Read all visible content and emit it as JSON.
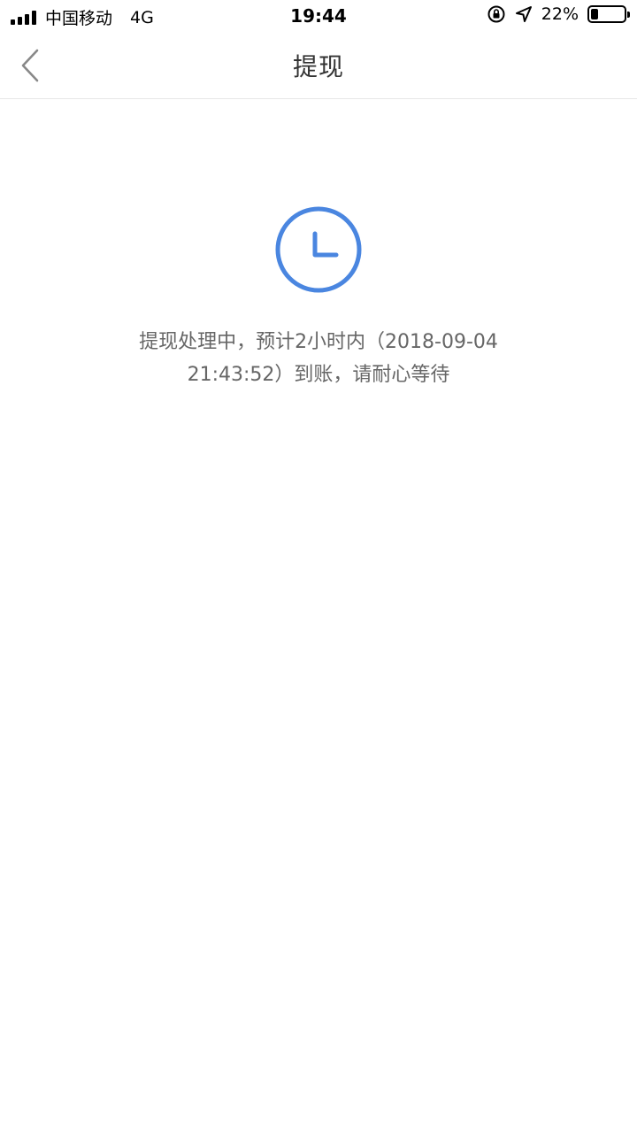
{
  "status_bar": {
    "carrier": "中国移动",
    "network": "4G",
    "time": "19:44",
    "battery_percent": "22%",
    "battery_level": 0.22,
    "icons": [
      "signal-icon",
      "orientation-lock-icon",
      "location-arrow-icon",
      "battery-icon"
    ]
  },
  "nav": {
    "title": "提现",
    "back_icon": "chevron-left-icon"
  },
  "status": {
    "icon": "clock-icon",
    "icon_color": "#4a86e0",
    "message": "提现处理中，预计2小时内（2018-09-04 21:43:52）到账，请耐心等待"
  }
}
